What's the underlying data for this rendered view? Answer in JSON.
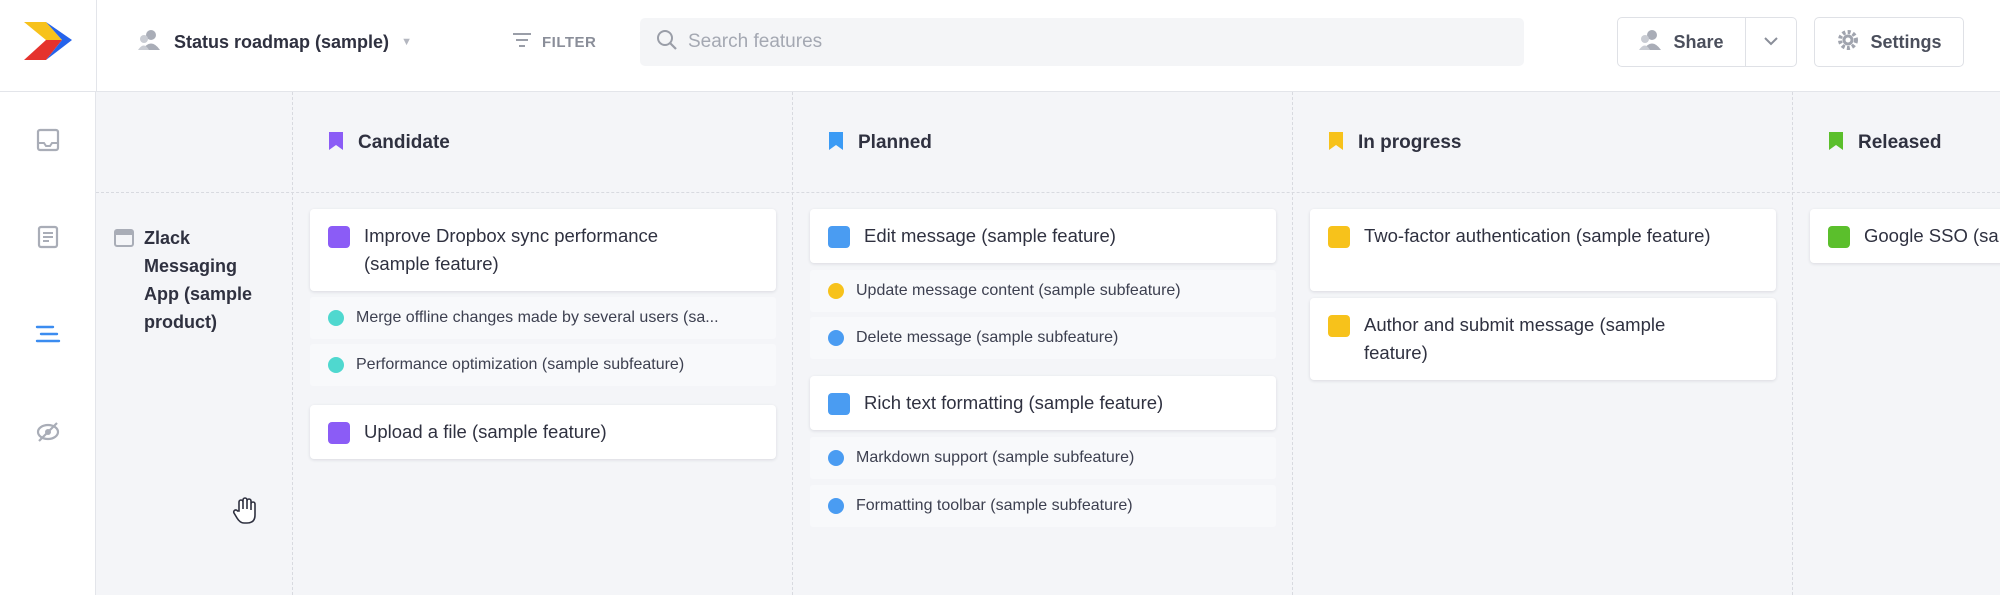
{
  "colors": {
    "candidate": "#8b5cf6",
    "planned": "#3b9bf5",
    "in_progress": "#f7c21b",
    "released": "#5bbf2c",
    "subfeature_candidate": "#4fd8cf",
    "subfeature_planned_yellow": "#f7c21b",
    "subfeature_planned_blue": "#4a9cf2"
  },
  "header": {
    "roadmap_name": "Status roadmap (sample)",
    "filter_label": "FILTER",
    "search_placeholder": "Search features",
    "share_label": "Share",
    "settings_label": "Settings"
  },
  "nav": [
    "inbox-icon",
    "notes-icon",
    "roadmap-icon",
    "hidden-icon"
  ],
  "product": {
    "name": "Zlack Messaging App (sample product)"
  },
  "columns": [
    {
      "title": "Candidate",
      "color": "#8b5cf6"
    },
    {
      "title": "Planned",
      "color": "#3b9bf5"
    },
    {
      "title": "In progress",
      "color": "#f7c21b"
    },
    {
      "title": "Released",
      "color": "#5bbf2c"
    }
  ],
  "candidate": {
    "features": [
      {
        "label": "Improve Dropbox sync performance (sample feature)"
      },
      {
        "label": "Upload a file (sample feature)"
      }
    ],
    "subfeatures": [
      {
        "label": "Merge offline changes made by several users (sa..."
      },
      {
        "label": "Performance optimization (sample subfeature)"
      }
    ]
  },
  "planned": {
    "features": [
      {
        "label": "Edit message (sample feature)"
      },
      {
        "label": "Rich text formatting (sample feature)"
      }
    ],
    "subfeatures": [
      {
        "label": "Update message content (sample subfeature)"
      },
      {
        "label": "Delete message (sample subfeature)"
      },
      {
        "label": "Markdown support (sample subfeature)"
      },
      {
        "label": "Formatting toolbar (sample subfeature)"
      }
    ]
  },
  "in_progress": {
    "features": [
      {
        "label": "Two-factor authentication (sample feature)"
      },
      {
        "label": "Author and submit message (sample feature)"
      }
    ]
  },
  "released": {
    "features": [
      {
        "label": "Google SSO (sar"
      }
    ]
  }
}
